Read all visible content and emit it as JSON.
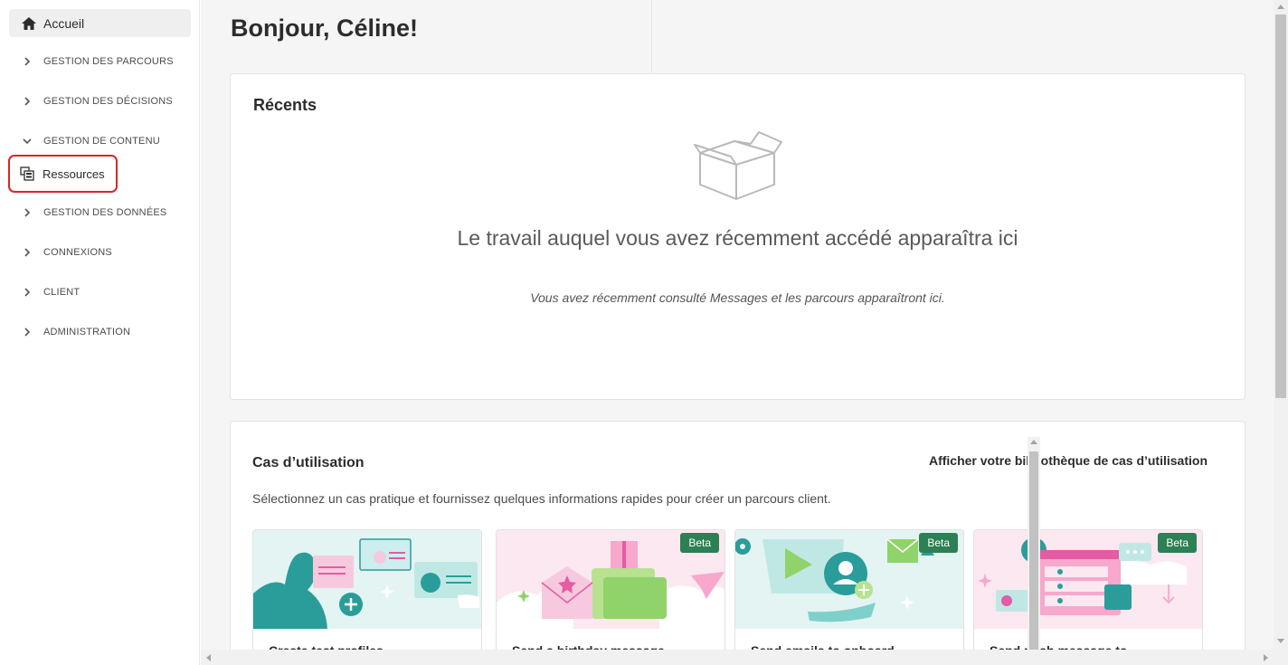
{
  "sidebar": {
    "home_label": "Accueil",
    "sections": [
      {
        "label": "GESTION DES PARCOURS",
        "expanded": false
      },
      {
        "label": "GESTION DES DÉCISIONS",
        "expanded": false
      },
      {
        "label": "GESTION DE CONTENU",
        "expanded": true
      },
      {
        "label": "GESTION DES DONNÉES",
        "expanded": false
      },
      {
        "label": "CONNEXIONS",
        "expanded": false
      },
      {
        "label": "CLIENT",
        "expanded": false
      },
      {
        "label": "ADMINISTRATION",
        "expanded": false
      }
    ],
    "sub_item_label": "Ressources",
    "highlight_color": "#d7262a"
  },
  "main": {
    "greeting": "Bonjour, Céline!",
    "recents": {
      "title": "Récents",
      "empty_heading": "Le travail auquel vous avez récemment accédé apparaîtra ici",
      "empty_sub": "Vous avez récemment consulté Messages et les parcours apparaîtront ici."
    },
    "use_cases": {
      "title": "Cas d’utilisation",
      "library_link": "Afficher votre bibliothèque de cas d’utilisation",
      "description": "Sélectionnez un cas pratique et fournissez quelques informations rapides pour créer un parcours client.",
      "cards": [
        {
          "caption": "Create test profiles",
          "badge": ""
        },
        {
          "caption": "Send a birthday message",
          "badge": "Beta"
        },
        {
          "caption": "Send emails to onboard",
          "badge": "Beta"
        },
        {
          "caption": "Send push message to",
          "badge": "Beta"
        }
      ]
    }
  },
  "colors": {
    "badge": "#2d8054",
    "teal": "#2a9d9a",
    "pink": "#e35ca4",
    "green": "#8fd36a"
  }
}
